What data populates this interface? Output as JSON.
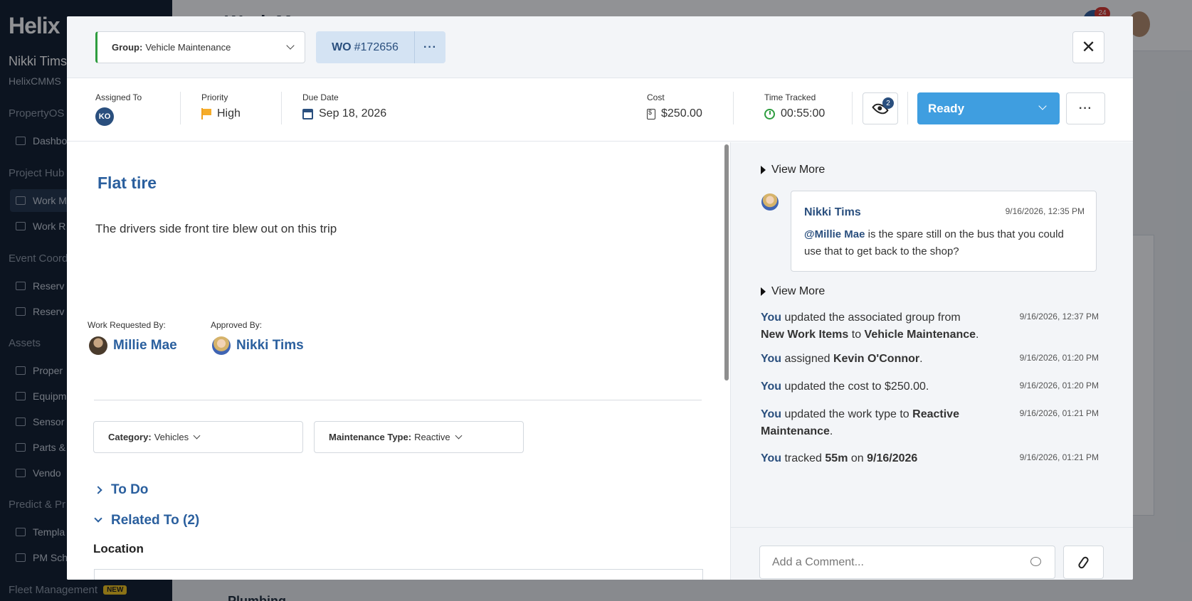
{
  "background": {
    "brand": "Helix",
    "user_name": "Nikki Tims",
    "org": "HelixCMMS",
    "page_title": "Work M",
    "notif_count": "24",
    "sections": [
      "PropertyOS",
      "Project Hub",
      "Event Coord",
      "Assets",
      "Predict & Pr",
      "Fleet Management"
    ],
    "nav_items": [
      "Dashbo",
      "Work M",
      "Work R",
      "Reserv",
      "Reserv",
      "Proper",
      "Equipm",
      "Sensor",
      "Parts &",
      "Vendo",
      "Templa",
      "PM Sch"
    ],
    "new_badge": "NEW",
    "footer_item": "Plumbing"
  },
  "header": {
    "group_label": "Group:",
    "group_value": "Vehicle Maintenance",
    "wo_prefix": "WO",
    "wo_number": "#172656",
    "wo_more": "···",
    "close": "✕"
  },
  "meta": {
    "assigned_label": "Assigned To",
    "assigned_initials": "KO",
    "priority_label": "Priority",
    "priority_value": "High",
    "due_label": "Due Date",
    "due_value": "Sep 18, 2026",
    "cost_label": "Cost",
    "cost_value": "$250.00",
    "time_label": "Time Tracked",
    "time_value": "00:55:00",
    "watchers_count": "2",
    "status": "Ready",
    "more": "···"
  },
  "work_order": {
    "title": "Flat tire",
    "description": "The drivers side front tire blew out on this trip",
    "requested_by_label": "Work Requested By:",
    "requested_by": "Millie Mae",
    "approved_by_label": "Approved By:",
    "approved_by": "Nikki Tims",
    "category_label": "Category:",
    "category_value": "Vehicles",
    "maint_type_label": "Maintenance Type:",
    "maint_type_value": "Reactive",
    "todo_label": "To Do",
    "related_label": "Related To (2)",
    "location_label": "Location"
  },
  "activity": {
    "view_more": "View More",
    "comment": {
      "author": "Nikki Tims",
      "timestamp": "9/16/2026, 12:35 PM",
      "mention": "@Millie Mae",
      "text": " is the spare still on the bus that you could use that to get back to the shop?"
    },
    "you": "You",
    "entries": [
      {
        "t1": " updated the associated group from ",
        "b1": "New Work Items",
        "t2": " to ",
        "b2": "Vehicle Maintenance",
        "t3": ".",
        "ts": "9/16/2026, 12:37 PM"
      },
      {
        "t1": " assigned ",
        "b1": "Kevin O'Connor",
        "t2": ".",
        "ts": "9/16/2026, 01:20 PM"
      },
      {
        "t1": " updated the cost to $250.00.",
        "ts": "9/16/2026, 01:20 PM"
      },
      {
        "t1": " updated the work type to ",
        "b1": "Reactive Maintenance",
        "t2": ".",
        "ts": "9/16/2026, 01:21 PM"
      },
      {
        "t1": " tracked ",
        "b1": "55m",
        "t2": " on ",
        "b2": "9/16/2026",
        "ts": "9/16/2026, 01:21 PM"
      }
    ],
    "comment_placeholder": "Add a Comment..."
  }
}
